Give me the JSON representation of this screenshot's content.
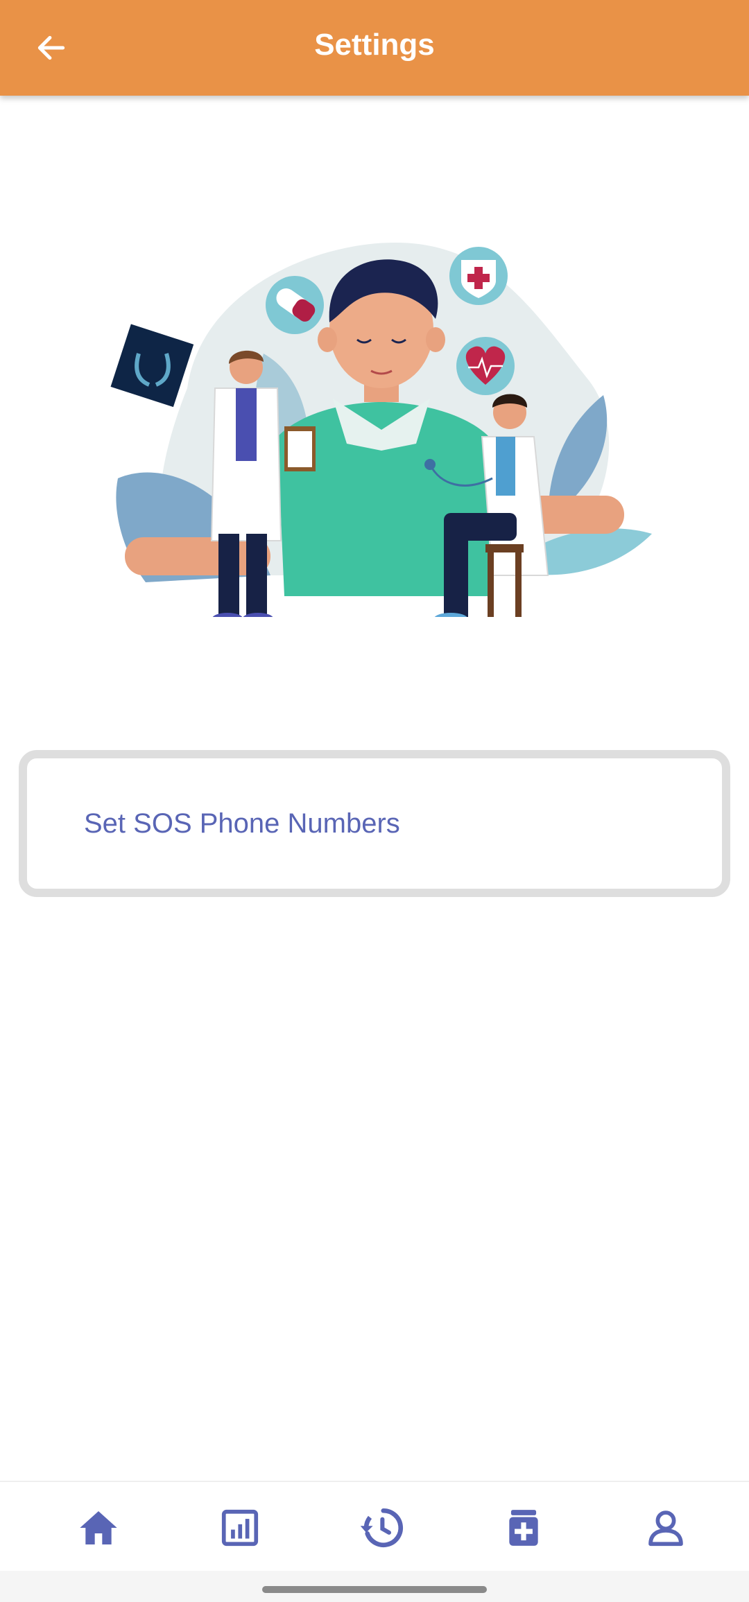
{
  "app_bar": {
    "title": "Settings",
    "back_icon": "arrow-left-icon",
    "background": "#E99247"
  },
  "hero": {
    "icon": "medical-illustration"
  },
  "settings": {
    "items": [
      {
        "label": "Set SOS Phone Numbers"
      }
    ]
  },
  "bottom_nav": {
    "accent": "#5965B5",
    "items": [
      {
        "icon": "home-icon"
      },
      {
        "icon": "bar-chart-icon"
      },
      {
        "icon": "history-icon"
      },
      {
        "icon": "medicine-box-icon"
      },
      {
        "icon": "profile-icon"
      }
    ]
  }
}
